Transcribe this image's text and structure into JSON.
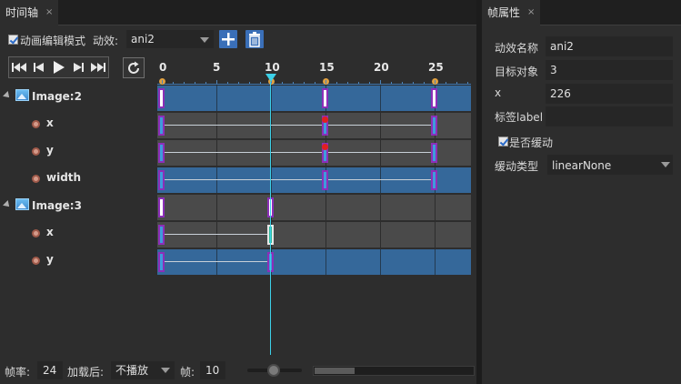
{
  "timeline": {
    "tab_label": "时间轴",
    "tab_close": "×",
    "edit_mode_label": "动画编辑模式",
    "edit_mode_checked": true,
    "effect_label": "动效:",
    "effect_value": "ani2",
    "ruler_labels": [
      "0",
      "5",
      "10",
      "15",
      "20",
      "25"
    ],
    "playhead_frame": 10,
    "tree": [
      {
        "label": "Image:2",
        "type": "node"
      },
      {
        "label": "x",
        "type": "prop"
      },
      {
        "label": "y",
        "type": "prop"
      },
      {
        "label": "width",
        "type": "prop"
      },
      {
        "label": "Image:3",
        "type": "node"
      },
      {
        "label": "x",
        "type": "prop"
      },
      {
        "label": "y",
        "type": "prop"
      }
    ]
  },
  "bottom": {
    "fps_label": "帧率:",
    "fps_value": "24",
    "after_load_label": "加载后:",
    "after_load_value": "不播放",
    "frame_label": "帧:",
    "frame_value": "10"
  },
  "frame_props": {
    "tab_label": "帧属性",
    "tab_close": "×",
    "name_label": "动效名称",
    "name_value": "ani2",
    "target_label": "目标对象",
    "target_value": "3",
    "x_label": "x",
    "x_value": "226",
    "tag_label": "标签label",
    "tag_value": "",
    "ease_checkbox_label": "是否缓动",
    "ease_checked": true,
    "ease_type_label": "缓动类型",
    "ease_type_value": "linearNone"
  }
}
